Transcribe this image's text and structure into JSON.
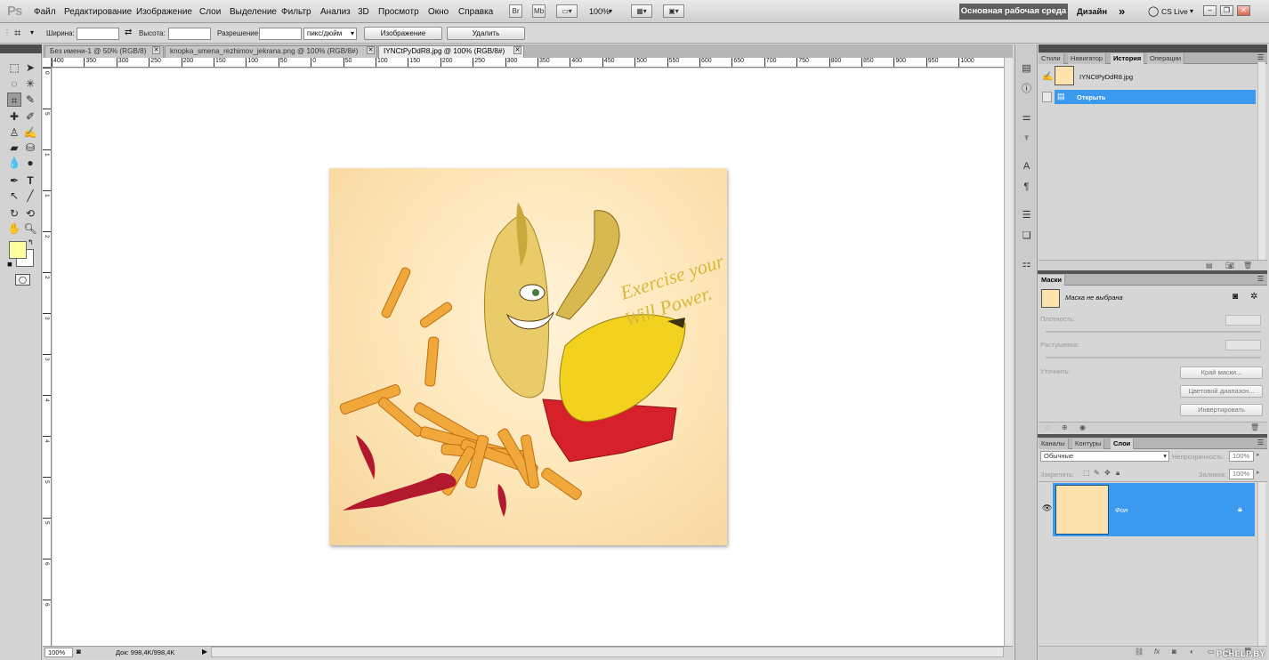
{
  "app": {
    "logo": "Ps"
  },
  "menu": [
    "Файл",
    "Редактирование",
    "Изображение",
    "Слои",
    "Выделение",
    "Фильтр",
    "Анализ",
    "3D",
    "Просмотр",
    "Окно",
    "Справка"
  ],
  "menubar_buttons": {
    "bridge": "Br",
    "mini_bridge": "Mb",
    "zoom": "100%"
  },
  "workspace": {
    "active": "Основная рабочая среда",
    "design": "Дизайн",
    "more": "»",
    "cslive": "CS Live"
  },
  "window_controls": {
    "minimize": "–",
    "restore": "❐",
    "close": "✕"
  },
  "options": {
    "width_label": "Ширина:",
    "height_label": "Высота:",
    "resolution_label": "Разрешение:",
    "unit_value": "пикс/дюйм",
    "image_button": "Изображение",
    "delete_button": "Удалить",
    "width_value": "",
    "height_value": "",
    "resolution_value": ""
  },
  "tabs": [
    {
      "label": "Без имени-1 @ 50% (RGB/8)",
      "close": "✕"
    },
    {
      "label": "knopka_smena_rezhimov_jekrana.png @ 100% (RGB/8#)",
      "close": "✕"
    },
    {
      "label": "IYNCtPyDdR8.jpg @ 100% (RGB/8#)",
      "close": "✕"
    }
  ],
  "ruler_top": [
    "400",
    "350",
    "300",
    "250",
    "200",
    "150",
    "100",
    "50",
    "0",
    "50",
    "100",
    "150",
    "200",
    "250",
    "300",
    "350",
    "400",
    "450",
    "500",
    "550",
    "600",
    "650",
    "700",
    "750",
    "800",
    "850",
    "900",
    "950",
    "1000"
  ],
  "ruler_left": [
    "0",
    "5",
    "1",
    "1",
    "2",
    "2",
    "3",
    "3",
    "4",
    "4",
    "5",
    "5",
    "6",
    "6"
  ],
  "artwork": {
    "slogan_line1": "Exercise your",
    "slogan_line2": "Will Power."
  },
  "status": {
    "zoom": "100%",
    "doc": "Док: 998,4K/998,4K"
  },
  "panels": {
    "top_tabs": [
      "Стили",
      "Навигатор",
      "История",
      "Операции"
    ],
    "history": {
      "snapshot": "IYNCtPyDdR8.jpg",
      "items": [
        {
          "label": "Открыть"
        }
      ]
    },
    "masks": {
      "tab": "Маски",
      "no_mask": "Маска не выбрана",
      "density_label": "Плотность:",
      "feather_label": "Растушевка:",
      "refine_label": "Уточнить:",
      "btn_edge": "Край маски...",
      "btn_color_range": "Цветовой диапазон...",
      "btn_invert": "Инвертировать"
    },
    "layers": {
      "tabs": [
        "Каналы",
        "Контуры",
        "Слои"
      ],
      "blend_mode": "Обычные",
      "opacity_label": "Непрозрачность:",
      "opacity_value": "100%",
      "lock_label": "Закрепить:",
      "fill_label": "Заливка:",
      "fill_value": "100%",
      "layer_name": "Фон"
    }
  },
  "watermark": "PCHELP.BY",
  "colors": {
    "accent": "#3a9af0",
    "fg_swatch": "#ffffa0",
    "bg_swatch": "#ffffff"
  }
}
